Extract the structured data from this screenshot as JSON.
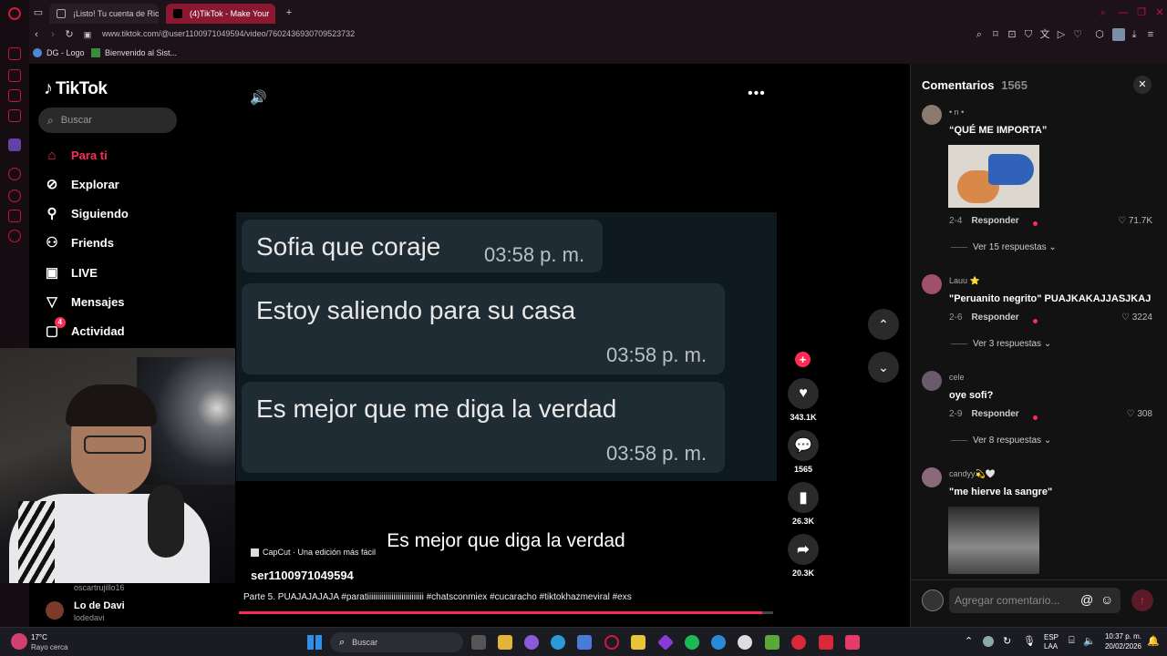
{
  "browser": {
    "tabs": [
      {
        "title": "¡Listo! Tu cuenta de Riot y"
      },
      {
        "title": "(4)TikTok - Make Your"
      }
    ],
    "url": "www.tiktok.com/@user1100971049594/video/7602436930709523732",
    "bookmarks": [
      {
        "label": "DG - Logo"
      },
      {
        "label": "Bienvenido al Sist..."
      }
    ]
  },
  "tiktok": {
    "logo": "TikTok",
    "search_placeholder": "Buscar",
    "menu": [
      {
        "label": "Para ti",
        "icon": "home-icon"
      },
      {
        "label": "Explorar",
        "icon": "compass-icon"
      },
      {
        "label": "Siguiendo",
        "icon": "following-icon"
      },
      {
        "label": "Friends",
        "icon": "friends-icon"
      },
      {
        "label": "LIVE",
        "icon": "live-icon"
      },
      {
        "label": "Mensajes",
        "icon": "messages-icon"
      },
      {
        "label": "Actividad",
        "icon": "activity-icon",
        "badge": "4"
      }
    ],
    "following": [
      {
        "name": "oscartrujillo16",
        "handle": ""
      },
      {
        "name": "Lo de Davi",
        "handle": "lodedavi"
      }
    ]
  },
  "video": {
    "messages": [
      {
        "text": "Sofia que coraje",
        "time": "03:58 p. m."
      },
      {
        "text": "Estoy saliendo para su casa",
        "time": "03:58 p. m."
      },
      {
        "text": "Es mejor que me diga la verdad",
        "time": "03:58 p. m."
      }
    ],
    "subtitle": "Es mejor que diga la verdad",
    "capcut": "CapCut · Una edición más fácil",
    "author": "ser1100971049594",
    "description": "Parte 5. PUAJAJAJAJA #paratiiiiiiiiiiiiiiiiiiiiiiiiiiii #chatsconmiex #cucaracho #tiktokhazmeviral #exs",
    "progress": 0.98,
    "actions": {
      "likes": "343.1K",
      "comments": "1565",
      "saves": "26.3K",
      "shares": "20.3K"
    }
  },
  "comments_panel": {
    "title": "Comentarios",
    "count": "1565",
    "items": [
      {
        "user": "• n •",
        "text": "“QUÉ ME IMPORTA”",
        "date": "2-4",
        "reply": "Responder",
        "likes": "71.7K",
        "replies": "Ver 15 respuestas"
      },
      {
        "user": "Lauu ⭐",
        "text": "\"Peruanito negrito\" PUAJKAKAJJASJKAJ",
        "date": "2-6",
        "reply": "Responder",
        "likes": "3224",
        "replies": "Ver 3 respuestas"
      },
      {
        "user": "cele",
        "text": "oye sofi?",
        "date": "2-9",
        "reply": "Responder",
        "likes": "308",
        "replies": "Ver 8 respuestas"
      },
      {
        "user": "candyy💫🤍",
        "text": "\"me hierve la sangre\""
      }
    ],
    "input_placeholder": "Agregar comentario..."
  },
  "taskbar": {
    "weather_temp": "17°C",
    "weather_desc": "Rayo cerca",
    "search": "Buscar",
    "lang": "ESP",
    "lang2": "LAA",
    "time": "10:37 p. m.",
    "date": "20/02/2026"
  },
  "colors": {
    "accent": "#fe2c55",
    "opera": "#c8143c"
  }
}
